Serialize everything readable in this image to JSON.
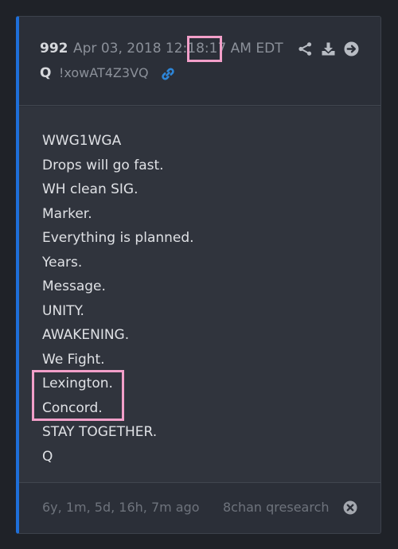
{
  "post": {
    "number": "992",
    "date": "Apr 03, 2018 12:18:17 AM EDT",
    "author": "Q",
    "tripcode": "!xowAT4Z3VQ"
  },
  "body": {
    "lines": [
      "WWG1WGA",
      "Drops will go fast.",
      "WH clean SIG.",
      "Marker.",
      "Everything is planned.",
      "Years.",
      "Message.",
      "UNITY.",
      "AWAKENING.",
      "We Fight.",
      "Lexington.",
      "Concord.",
      "STAY TOGETHER.",
      "Q"
    ]
  },
  "footer": {
    "elapsed": "6y, 1m, 5d, 16h, 7m ago",
    "source": "8chan qresearch"
  },
  "icons": {
    "actions": [
      "share-icon",
      "download-icon",
      "arrow-right-circle-icon"
    ],
    "link": "link-icon",
    "close": "close-circle-icon"
  },
  "colors": {
    "accent_bar": "#1e6fd9",
    "link": "#2d86d9",
    "highlight": "#f29fc9"
  }
}
